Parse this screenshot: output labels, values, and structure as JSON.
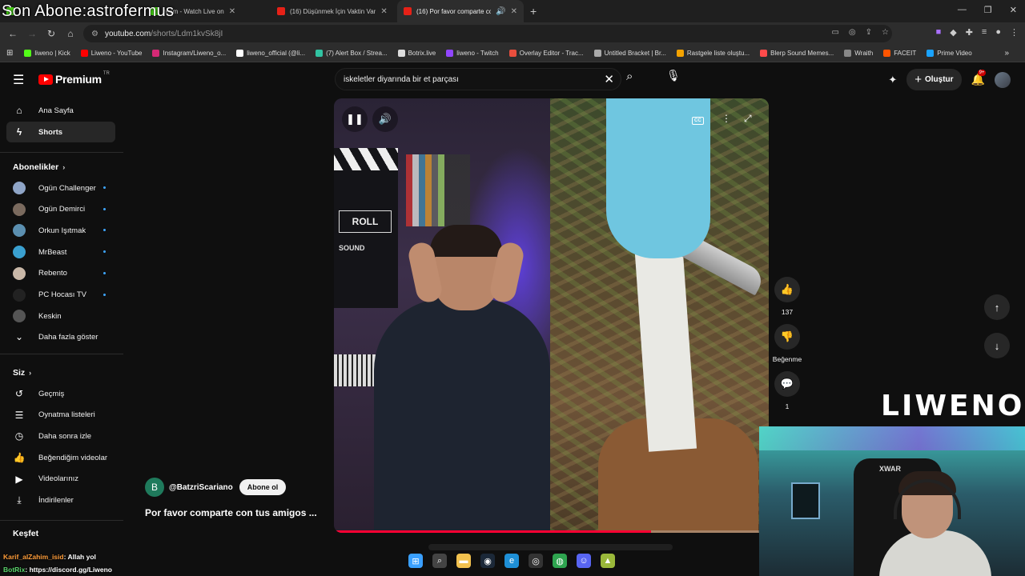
{
  "overlay": {
    "title": "Son Abone:astrofermus"
  },
  "browser": {
    "tabs": [
      {
        "label": "…",
        "active": false
      },
      {
        "label": "ream - Watch Live on",
        "active": false
      },
      {
        "label": "(16) Düşünmek İçin Vaktin Var",
        "active": false
      },
      {
        "label": "(16) Por favor comparte co",
        "active": true
      }
    ],
    "url_domain": "youtube.com",
    "url_path": "/shorts/Ldm1kvSk8jI",
    "bookmarks": [
      {
        "label": "liweno | Kick",
        "color": "#53fc18"
      },
      {
        "label": "Liweno - YouTube",
        "color": "#ff0000"
      },
      {
        "label": "Instagram/Liweno_o...",
        "color": "#d62976"
      },
      {
        "label": "liweno_official (@li...",
        "color": "#ffffff"
      },
      {
        "label": "(7) Alert Box / Strea...",
        "color": "#31c3a2"
      },
      {
        "label": "Botrix.live",
        "color": "#dddddd"
      },
      {
        "label": "liweno - Twitch",
        "color": "#9146ff"
      },
      {
        "label": "Overlay Editor - Trac...",
        "color": "#e94e3d"
      },
      {
        "label": "Untitled Bracket | Br...",
        "color": "#aaaaaa"
      },
      {
        "label": "Rastgele liste oluştu...",
        "color": "#f4a300"
      },
      {
        "label": "Blerp Sound Memes...",
        "color": "#ff4b4b"
      },
      {
        "label": "Wraith",
        "color": "#888888"
      },
      {
        "label": "FACEIT",
        "color": "#ff5500"
      },
      {
        "label": "Prime Video",
        "color": "#1aa3ff"
      }
    ]
  },
  "header": {
    "logo": "Premium",
    "logo_country": "TR",
    "search_value": "iskeletler diyarında bir et parçası",
    "create_label": "Oluştur",
    "notif_badge": "9+"
  },
  "sidebar": {
    "main": [
      {
        "label": "Ana Sayfa",
        "icon": "home-icon"
      },
      {
        "label": "Shorts",
        "icon": "shorts-icon"
      }
    ],
    "subs_title": "Abonelikler",
    "subs": [
      {
        "label": "Ogün Challenger",
        "color": "#8fa5c7"
      },
      {
        "label": "Ogün Demirci",
        "color": "#7a6a5e"
      },
      {
        "label": "Orkun Işıtmak",
        "color": "#5b8fb0"
      },
      {
        "label": "MrBeast",
        "color": "#3aa0d0"
      },
      {
        "label": "Rebento",
        "color": "#c9b8a8"
      },
      {
        "label": "PC Hocası TV",
        "color": "#222222"
      },
      {
        "label": "Keskin",
        "color": "#555555"
      }
    ],
    "show_more": "Daha fazla göster",
    "you_title": "Siz",
    "you": [
      {
        "label": "Geçmiş",
        "icon": "history-icon"
      },
      {
        "label": "Oynatma listeleri",
        "icon": "playlist-icon"
      },
      {
        "label": "Daha sonra izle",
        "icon": "clock-icon"
      },
      {
        "label": "Beğendiğim videolar",
        "icon": "like-icon"
      },
      {
        "label": "Videolarınız",
        "icon": "video-icon"
      },
      {
        "label": "İndirilenler",
        "icon": "download-icon"
      }
    ],
    "explore_title": "Keşfet"
  },
  "short": {
    "channel_initial": "B",
    "channel": "@BatzriScariano",
    "subscribe": "Abone ol",
    "title": "Por favor comparte con tus amigos ...",
    "progress": 0.73,
    "roll_text": "ROLL",
    "sound_text": "SOUND",
    "likes": "137",
    "dislike_label": "Beğenme",
    "comments": "1"
  },
  "stream": {
    "watermark": "LIWENO",
    "chair_logo": "XWAR",
    "chat": [
      {
        "user": "Karif_alZahim_isid",
        "msg": ": Allah yol",
        "color": "#ff9d3a"
      },
      {
        "user": "BotRix",
        "msg": ": https://discord.gg/Liweno",
        "color": "#5ad36b"
      }
    ]
  },
  "taskbar": [
    {
      "icon": "windows-icon",
      "color": "#3aa0ff"
    },
    {
      "icon": "search-icon",
      "color": "#444444"
    },
    {
      "icon": "folder-icon",
      "color": "#f2c14e"
    },
    {
      "icon": "steam-icon",
      "color": "#1b2838"
    },
    {
      "icon": "edge-icon",
      "color": "#1e8fd6"
    },
    {
      "icon": "obs-icon",
      "color": "#333333"
    },
    {
      "icon": "chrome-icon",
      "color": "#2ea44f"
    },
    {
      "icon": "discord-icon",
      "color": "#5865f2"
    },
    {
      "icon": "app-icon",
      "color": "#9ab83a"
    }
  ]
}
